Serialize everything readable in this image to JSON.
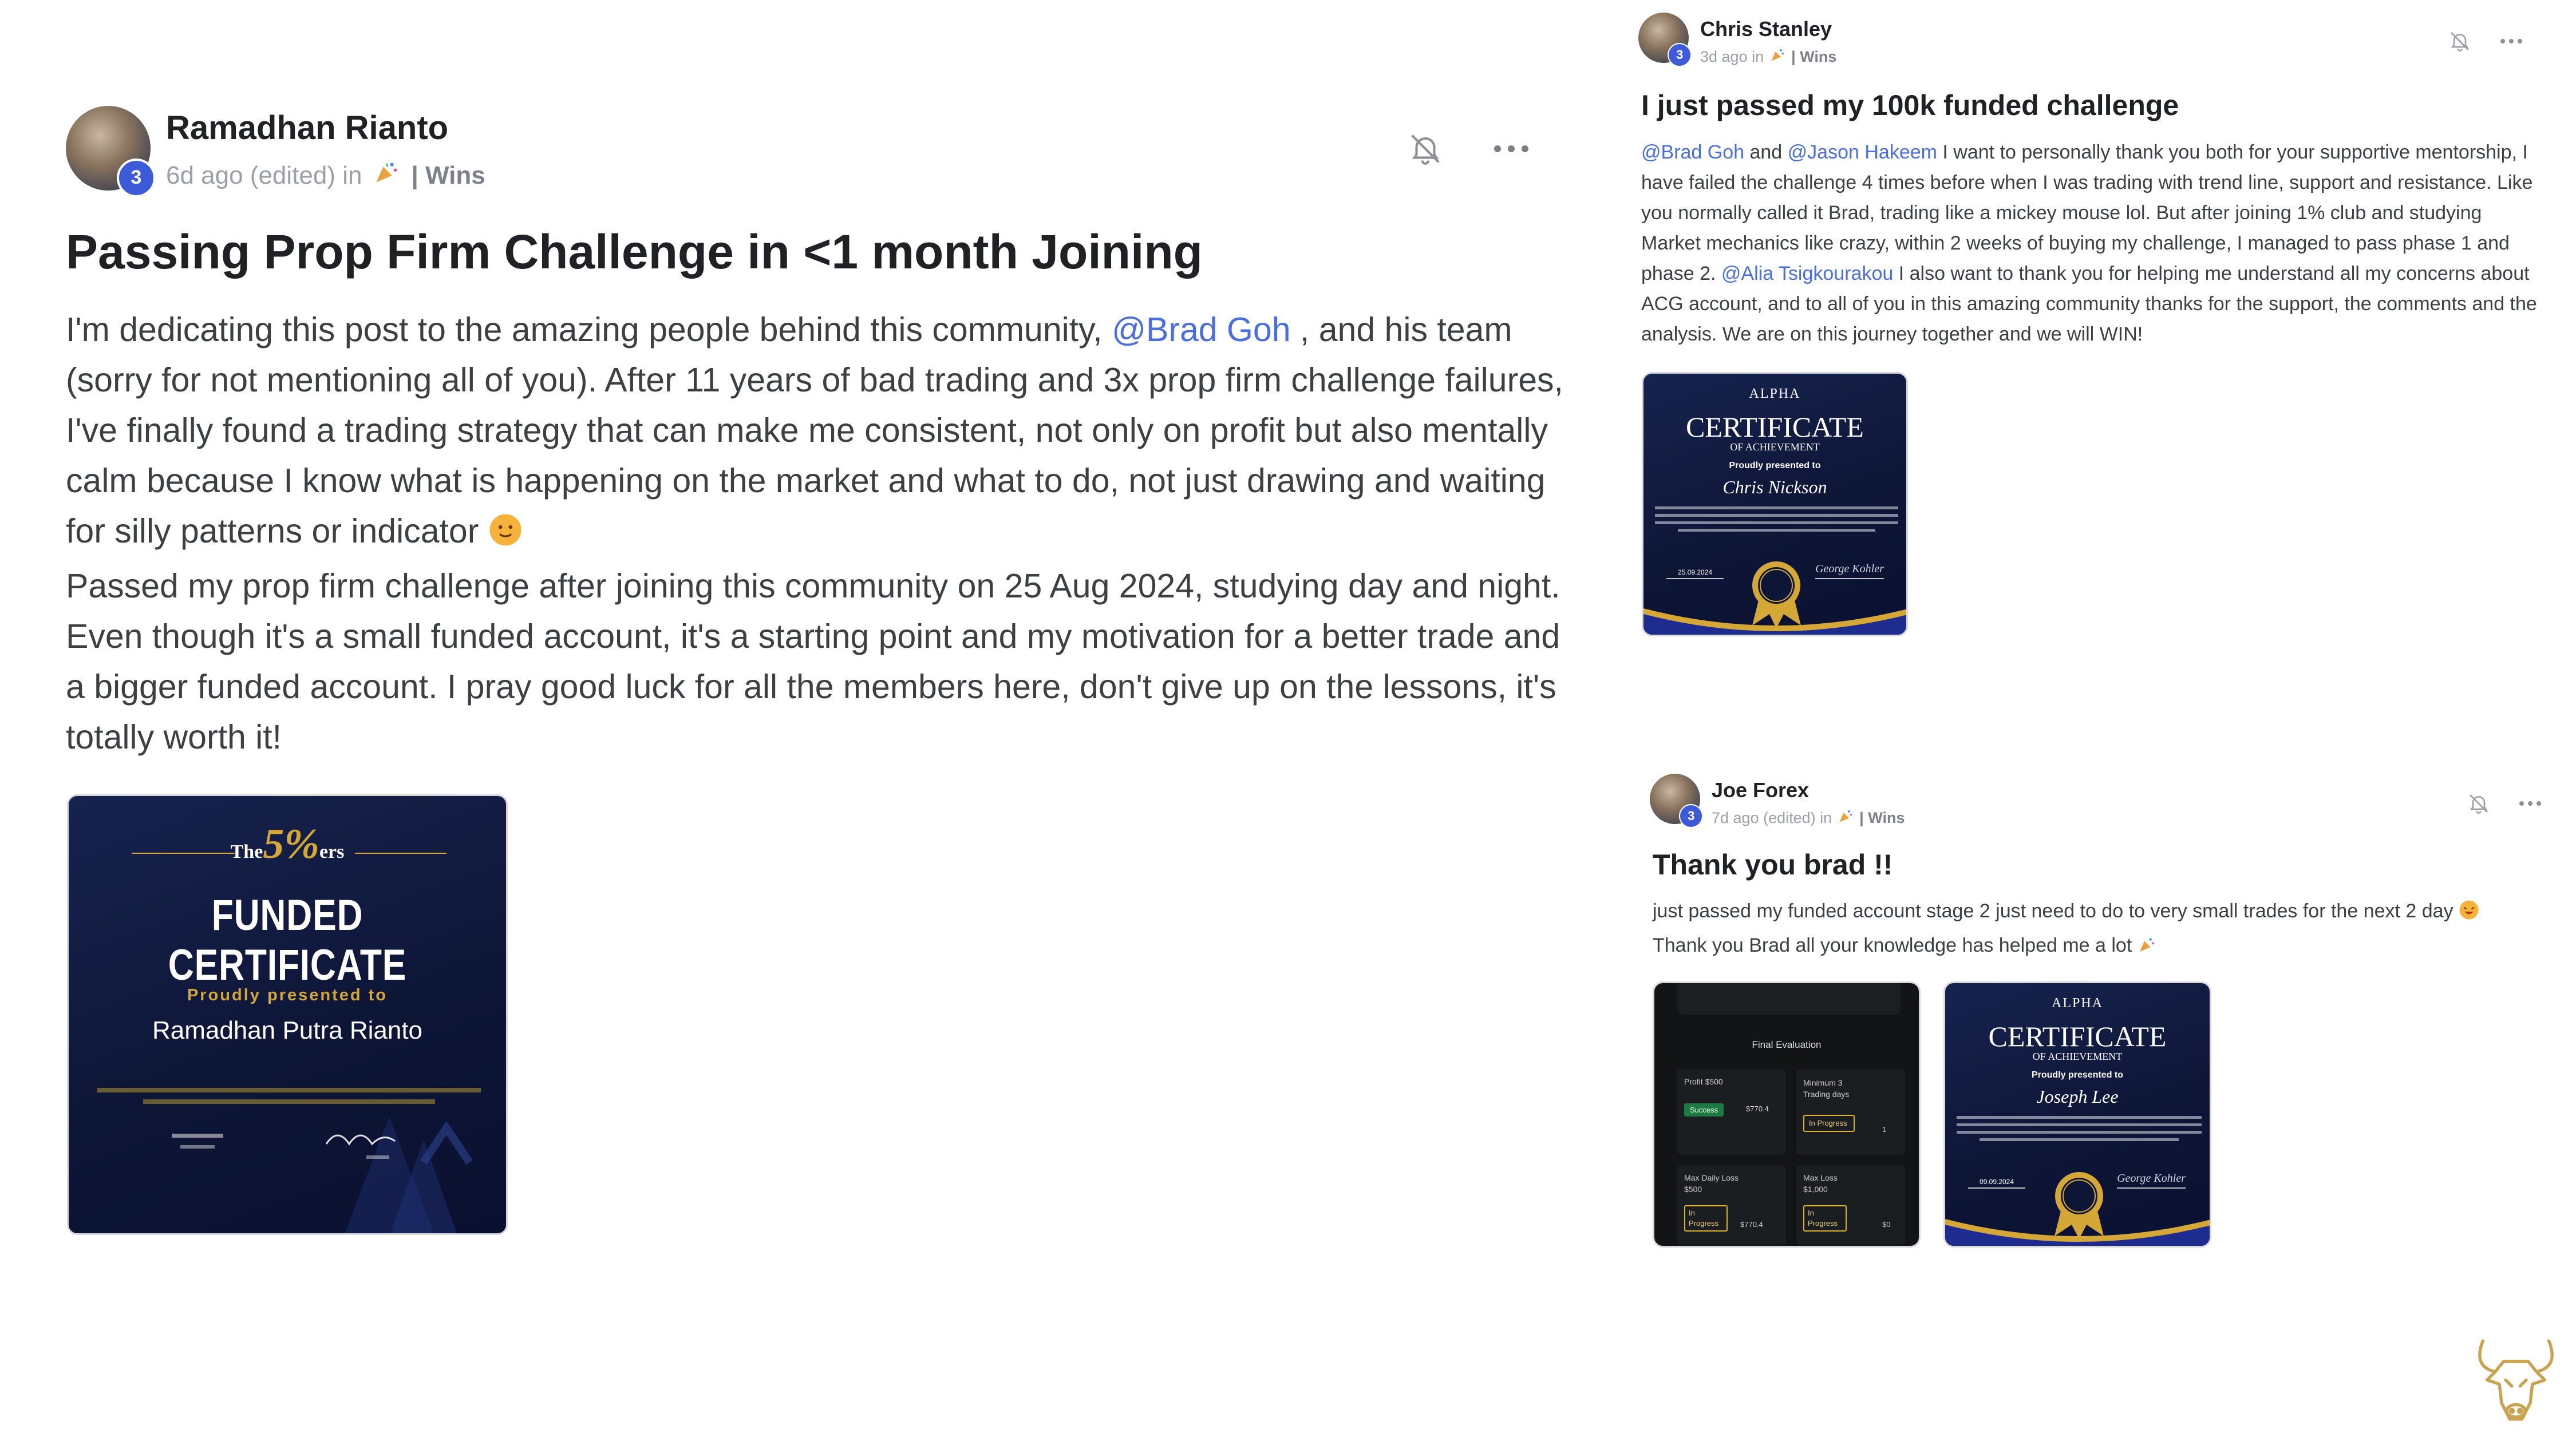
{
  "colors": {
    "mention": "#4a6ee0",
    "level_badge": "#3d5bd9",
    "cert_navy": "#0e1637",
    "cert_gold": "#d4a737"
  },
  "post_main": {
    "author": "Ramadhan Rianto",
    "level": "3",
    "meta_time": "6d ago (edited) in",
    "meta_icon": "party-popper-icon",
    "category": "| Wins",
    "title": "Passing Prop Firm Challenge in <1 month Joining",
    "para1_pre": "I'm dedicating this post to the amazing people behind this community, ",
    "para1_mention": "@Brad Goh",
    "para1_post": " , and his team (sorry for not mentioning all of you). After 11 years of bad trading and 3x prop firm challenge failures, I've finally found a trading strategy that can make me consistent, not only on profit but also mentally calm because I know what is happening on the market and what to do, not just drawing and waiting for silly patterns or indicator ",
    "para1_emoji": "face-emoji-icon",
    "para2": "Passed my prop firm challenge after joining this community on 25 Aug 2024, studying day and night. Even though it's a small funded account, it's a starting point and my motivation for a better trade and a bigger funded account. I pray good luck for all the members here, don't give up on the lessons, it's totally worth it!",
    "certificate": {
      "brand_prefix": "The",
      "brand_main": "5%",
      "brand_suffix": "ers",
      "heading": "FUNDED CERTIFICATE",
      "presented": "Proudly presented to",
      "name": "Ramadhan Putra Rianto"
    }
  },
  "post_right_top": {
    "author": "Chris Stanley",
    "level": "3",
    "meta_time": "3d ago in",
    "category": "| Wins",
    "title": "I just passed my 100k funded challenge",
    "mention1": "@Brad Goh",
    "text_and": " and ",
    "mention2": "@Jason Hakeem",
    "text_1": " I want to personally thank you both for your supportive mentorship, I have failed the challenge 4 times before when I was trading with trend line, support and resistance. Like you normally called it Brad, trading like a mickey mouse lol. But after joining 1% club and studying Market mechanics like crazy, within 2 weeks of buying my challenge, I managed to pass phase 1 and phase 2. ",
    "mention3": "@Alia Tsigkourakou",
    "text_2": " I also want to thank you for helping me understand all my concerns about ACG account, and to all of you in this amazing community thanks for the support, the comments and the analysis. We are on this journey together and we will WIN!",
    "certificate": {
      "brand": "ALPHA",
      "heading": "CERTIFICATE",
      "sub": "OF ACHIEVEMENT",
      "presented": "Proudly presented to",
      "name": "Chris Nickson",
      "date": "25.09.2024",
      "signature": "George Kohler"
    }
  },
  "post_right_bottom": {
    "author": "Joe Forex",
    "level": "3",
    "meta_time": "7d ago (edited) in",
    "category": "| Wins",
    "title": "Thank you brad !!",
    "line1": "just passed my funded account stage 2 just need to do to very small trades for the next 2 day",
    "line2": "Thank you Brad all your knowledge has helped me a lot",
    "evaluation": {
      "heading": "Final Evaluation",
      "profit_label": "Profit $500",
      "profit_status": "Success",
      "profit_value": "$770.4",
      "min_days_label": "Minimum 3 Trading days",
      "min_days_status": "In Progress",
      "min_days_value": "1",
      "daily_loss_label": "Max Daily Loss $500",
      "daily_loss_status": "In Progress",
      "daily_loss_value": "$770.4",
      "max_loss_label": "Max Loss $1,000",
      "max_loss_status": "In Progress",
      "max_loss_value": "$0"
    },
    "certificate": {
      "brand": "ALPHA",
      "heading": "CERTIFICATE",
      "sub": "OF ACHIEVEMENT",
      "presented": "Proudly presented to",
      "name": "Joseph Lee",
      "date": "09.09.2024",
      "signature": "George Kohler"
    }
  },
  "watermark": {
    "icon": "bull-head-logo-icon"
  }
}
